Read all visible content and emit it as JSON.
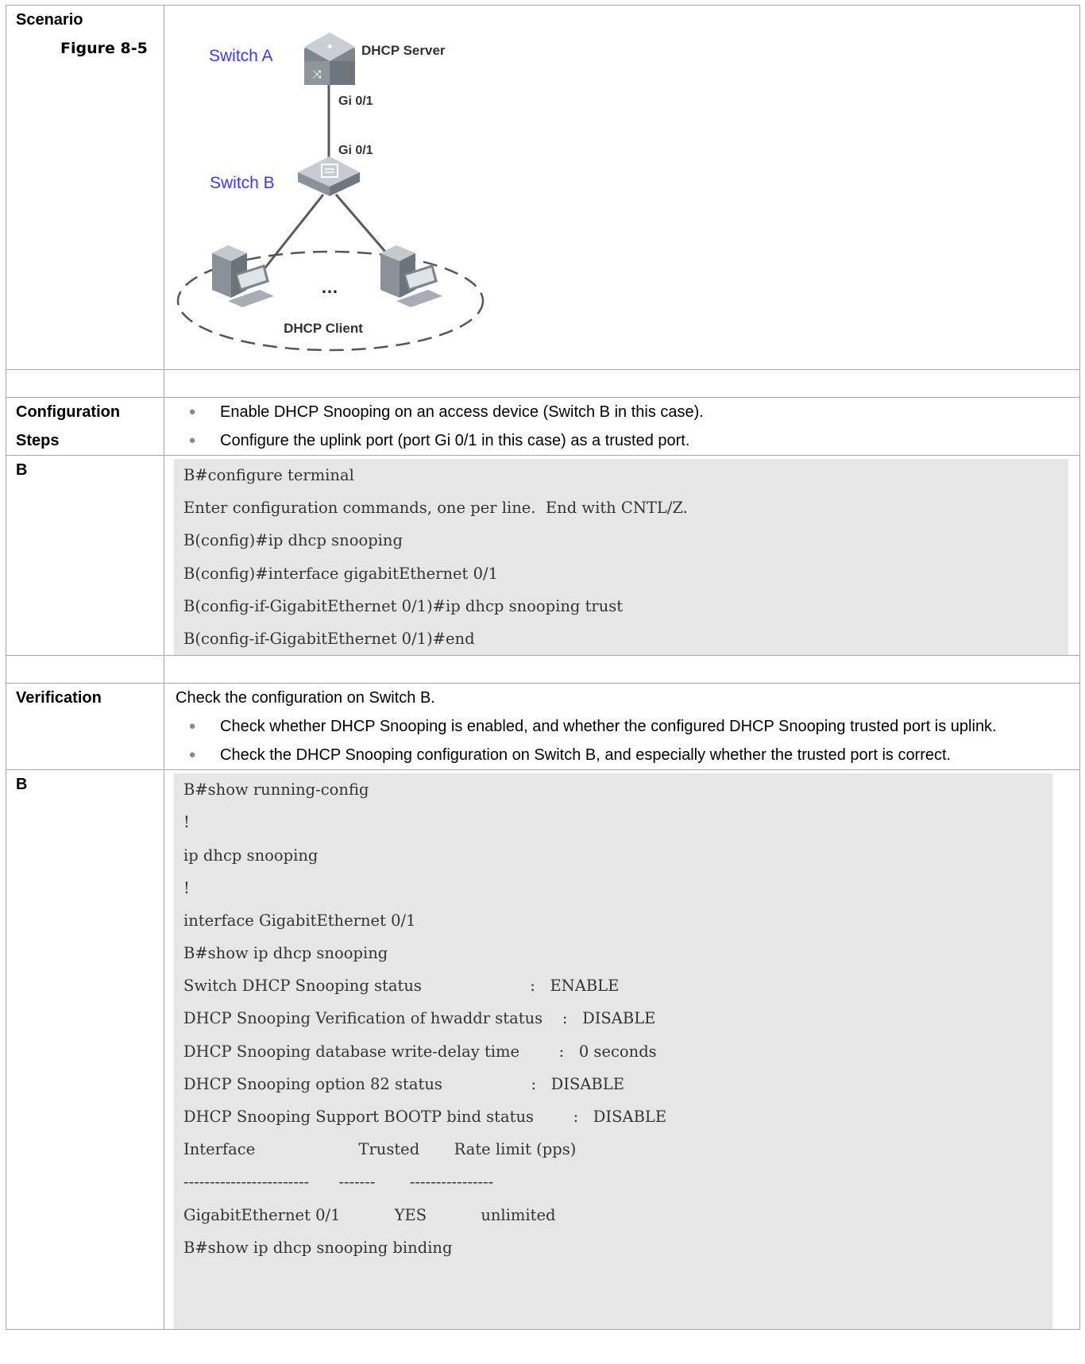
{
  "scenario": {
    "label": "Scenario",
    "figure_label": "Figure 8-5",
    "diagram": {
      "switch_a": "Switch A",
      "dhcp_server": "DHCP Server",
      "port_a": "Gi 0/1",
      "port_b": "Gi 0/1",
      "switch_b": "Switch B",
      "ellipsis": "…",
      "dhcp_client": "DHCP Client"
    }
  },
  "config_steps": {
    "label_line1": "Configuration",
    "label_line2": "Steps",
    "bullets": [
      "Enable DHCP Snooping on an access device (Switch B in this case).",
      "Configure the uplink port (port Gi 0/1 in this case) as a trusted port."
    ]
  },
  "config_code": {
    "label": "B",
    "lines": [
      "B#configure terminal",
      "Enter configuration commands, one per line.  End with CNTL/Z.",
      "B(config)#ip dhcp snooping",
      "B(config)#interface gigabitEthernet 0/1",
      "B(config-if-GigabitEthernet 0/1)#ip dhcp snooping trust",
      "B(config-if-GigabitEthernet 0/1)#end"
    ]
  },
  "verification": {
    "label": "Verification",
    "intro": "Check the configuration on Switch B.",
    "bullets": [
      "Check whether DHCP Snooping is enabled, and whether the configured DHCP Snooping trusted port is uplink.",
      "Check the DHCP Snooping configuration on Switch B, and especially whether the trusted port is correct."
    ]
  },
  "verify_code": {
    "label": "B",
    "lines": [
      "B#show running-config",
      "!",
      "ip dhcp snooping",
      "!",
      "interface GigabitEthernet 0/1",
      "B#show ip dhcp snooping",
      "Switch DHCP Snooping status                      :   ENABLE",
      "DHCP Snooping Verification of hwaddr status    :   DISABLE",
      "DHCP Snooping database write-delay time        :   0 seconds",
      "DHCP Snooping option 82 status                  :   DISABLE",
      "DHCP Snooping Support BOOTP bind status        :   DISABLE",
      "Interface                     Trusted       Rate limit (pps)",
      "------------------------      -------       ----------------",
      "GigabitEthernet 0/1           YES           unlimited",
      "B#show ip dhcp snooping binding"
    ]
  }
}
